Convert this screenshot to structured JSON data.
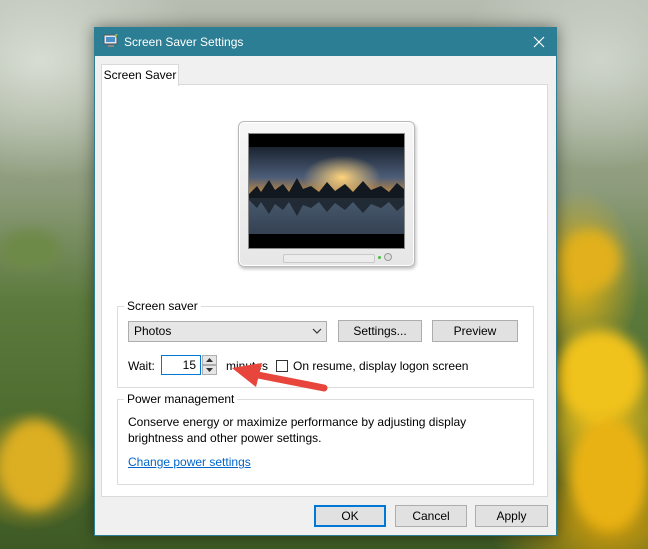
{
  "window": {
    "title": "Screen Saver Settings",
    "title_icon": "screen-saver-app-icon",
    "close_icon": "close-icon",
    "titlebar_color": "#2b7e93"
  },
  "tabs": [
    {
      "label": "Screen Saver",
      "selected": true
    }
  ],
  "preview": {
    "icon": "monitor-preview-icon",
    "image": "sunset-lake-photo"
  },
  "screen_saver": {
    "legend": "Screen saver",
    "selected": "Photos",
    "settings_label": "Settings...",
    "preview_label": "Preview",
    "wait_label": "Wait:",
    "wait_value": "15",
    "minutes_label": "minutes",
    "resume_label": "On resume, display logon screen",
    "resume_checked": false
  },
  "power": {
    "legend": "Power management",
    "description_line1": "Conserve energy or maximize performance by adjusting display",
    "description_line2": "brightness and other power settings.",
    "link_label": "Change power settings"
  },
  "footer": {
    "ok_label": "OK",
    "cancel_label": "Cancel",
    "apply_label": "Apply"
  },
  "annotation": {
    "icon": "red-arrow-icon",
    "color": "#e8453c"
  },
  "colors": {
    "accent": "#0078d7",
    "link": "#0066cc"
  }
}
